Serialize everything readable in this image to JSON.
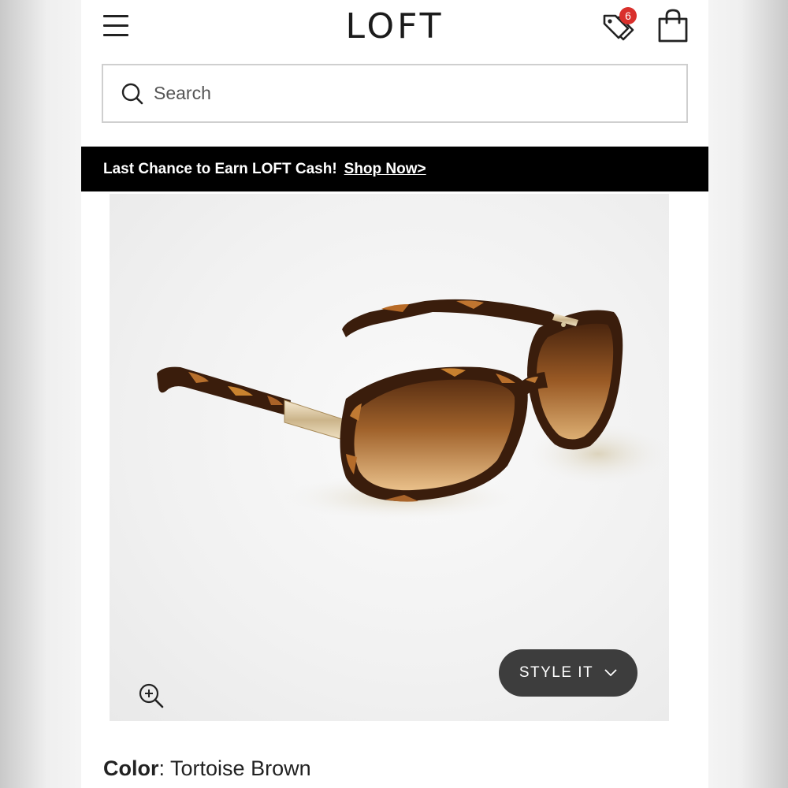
{
  "header": {
    "logo": "LOFT",
    "menu_icon": "hamburger-menu-icon",
    "wishlist_icon": "price-tags-icon",
    "wishlist_count": "6",
    "bag_icon": "shopping-bag-icon",
    "badge_color": "#d9302c"
  },
  "search": {
    "placeholder": "Search",
    "icon": "search-icon"
  },
  "promo": {
    "text": "Last Chance to Earn LOFT Cash!",
    "link": "Shop Now>"
  },
  "product": {
    "image_icon": "zoom-in-icon",
    "style_button": "STYLE IT",
    "style_button_icon": "chevron-down-icon",
    "color_label": "Color",
    "color_separator": ":",
    "color_value": "Tortoise Brown"
  }
}
